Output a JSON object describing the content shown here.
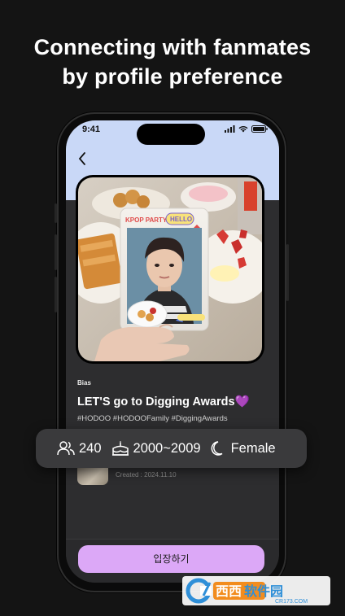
{
  "headline": {
    "line1": "Connecting with fanmates",
    "line2": "by profile preference"
  },
  "status_bar": {
    "time": "9:41"
  },
  "photo_card": {
    "sign_text": "KPOP PARTY",
    "sticker_text": "HELLO"
  },
  "room": {
    "bias_label": "Bias",
    "title": "LET'S go to Digging Awards💜",
    "hashtags": "#HODOO #HODOOFamily #DiggingAwards",
    "created": "Created : 2024.11.10"
  },
  "info": {
    "members": "240",
    "birth_range": "2000~2009",
    "gender": "Female"
  },
  "enter_button": {
    "label": "입장하기"
  },
  "watermark": {
    "brand": "西西软件园",
    "site": "CR173.COM"
  },
  "colors": {
    "header_bg": "#c9d8f7",
    "accent": "#dca8f7",
    "pill_bg": "#3a3a3c",
    "background": "#141414"
  }
}
